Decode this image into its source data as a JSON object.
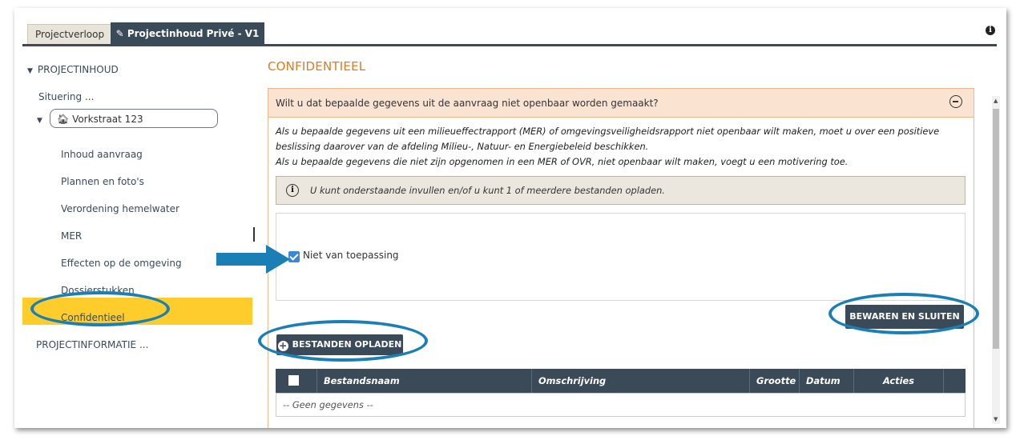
{
  "tabs": {
    "projectverloop": "Projectverloop",
    "projectinhoud": "Projectinhoud Privé - V1"
  },
  "sidebar": {
    "projectinhoud_label": "PROJECTINHOUD",
    "situering": "Situering ...",
    "address": "Vorkstraat 123",
    "items": [
      "Inhoud aanvraag",
      "Plannen en foto's",
      "Verordening hemelwater",
      "MER",
      "Effecten op de omgeving",
      "Dossierstukken",
      "Confidentieel"
    ],
    "projectinformatie": "PROJECTINFORMATIE ..."
  },
  "main": {
    "section_title": "CONFIDENTIEEL",
    "panel_question": "Wilt u dat bepaalde gegevens uit de aanvraag niet openbaar worden gemaakt?",
    "body_lines": [
      "Als u bepaalde gegevens uit een milieueffectrapport (MER) of omgevingsveiligheidsrapport niet openbaar wilt maken, moet u over een positieve",
      "beslissing daarover van de afdeling Milieu-, Natuur- en Energiebeleid beschikken.",
      "Als u bepaalde gegevens die niet zijn opgenomen in een MER of OVR, niet openbaar wilt maken, voegt u een motivering toe."
    ],
    "hint": "U kunt onderstaande invullen en/of u kunt 1 of meerdere bestanden opladen.",
    "checkbox_label": "Niet van toepassing",
    "checkbox_checked": true,
    "save_button": "BEWAREN EN SLUITEN",
    "upload_button": "BESTANDEN OPLADEN",
    "table": {
      "columns": [
        "Bestandsnaam",
        "Omschrijving",
        "Grootte",
        "Datum",
        "Acties"
      ],
      "empty": "-- Geen gegevens --"
    }
  },
  "colors": {
    "accent_orange": "#e07a1f",
    "dark_header": "#3b4a59",
    "active_yellow": "#ffcd2b",
    "annotation_blue": "#1a7fb5",
    "checkbox_blue": "#3a87d6"
  },
  "icons": {
    "pencil": "pencil-icon",
    "info": "info-icon",
    "home": "home-icon",
    "collapse": "minus-circle-icon",
    "hint": "info-circle-icon",
    "upload": "plus-circle-icon"
  }
}
